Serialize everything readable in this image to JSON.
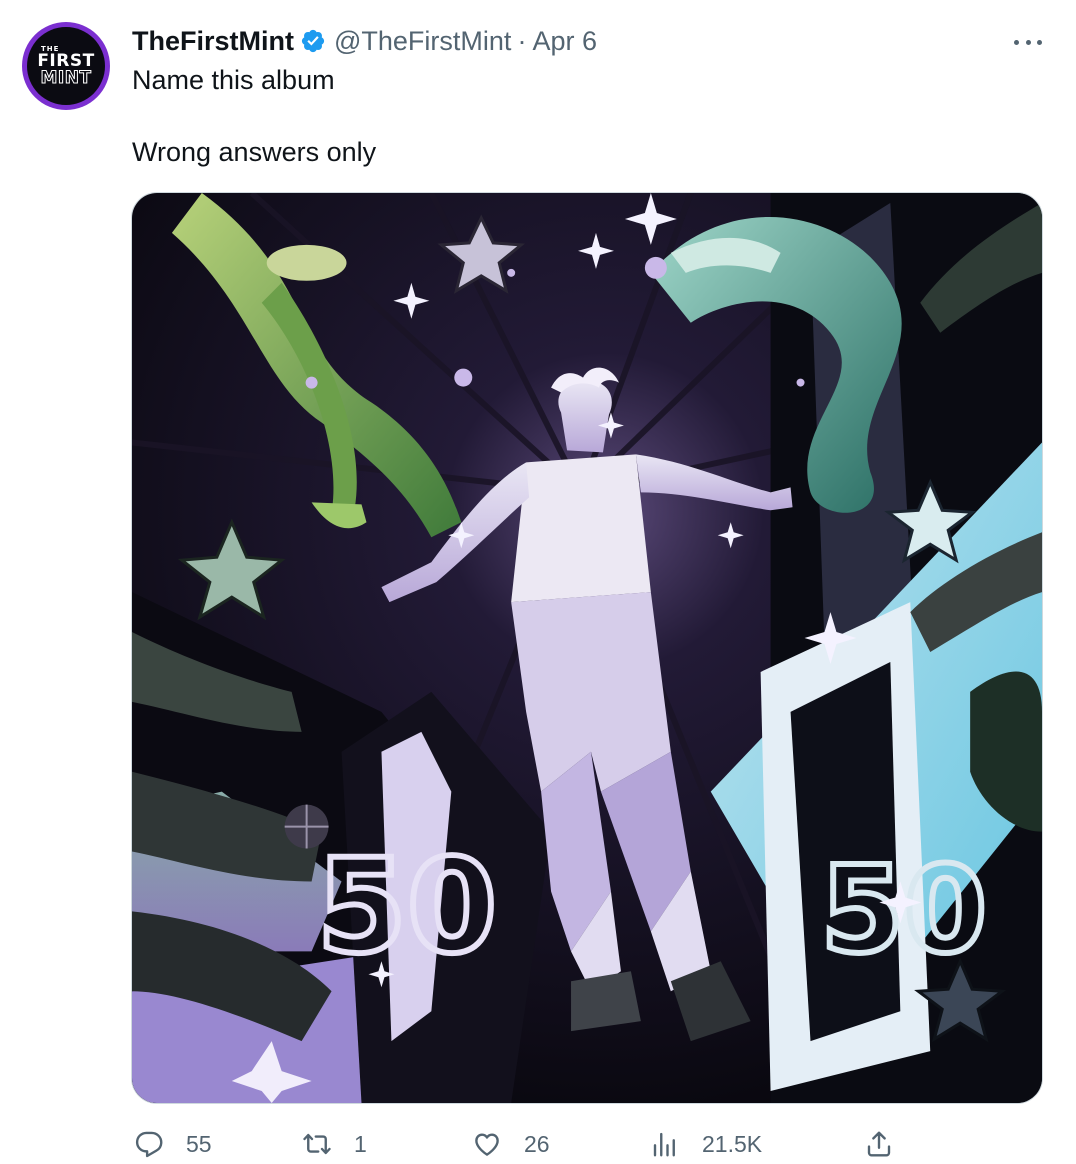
{
  "account": {
    "avatar_lines": [
      "THE",
      "FIRST",
      "MINT"
    ],
    "display_name": "TheFirstMint",
    "handle": "@TheFirstMint",
    "separator": "·",
    "date": "Apr 6",
    "verified": true
  },
  "tweet": {
    "lines": [
      "Name this album",
      "Wrong answers only"
    ]
  },
  "media": {
    "description_icon": "album-art-image"
  },
  "actions": {
    "replies": "55",
    "retweets": "1",
    "likes": "26",
    "views": "21.5K"
  },
  "colors": {
    "text_primary": "#0f1419",
    "text_secondary": "#536471",
    "verified_blue": "#1d9bf0",
    "avatar_ring": "#7b2fd0"
  },
  "icons": {
    "more": "more-dots-icon",
    "reply": "reply-icon",
    "retweet": "retweet-icon",
    "like": "heart-icon",
    "views": "views-icon",
    "share": "share-icon",
    "verified": "verified-badge-icon"
  }
}
